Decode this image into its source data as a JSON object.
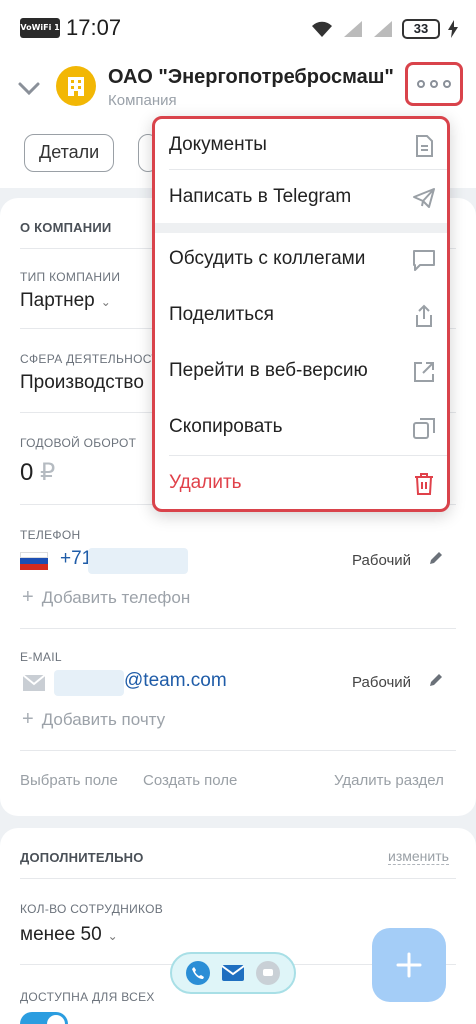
{
  "status_bar": {
    "network_badge": "VoWiFi 1",
    "time": "17:07",
    "battery": "33"
  },
  "header": {
    "title": "ОАО \"Энергопотребросмаш\"",
    "subtitle": "Компания"
  },
  "tabs": [
    {
      "label": "Детали"
    }
  ],
  "about": {
    "section_title": "О КОМПАНИИ",
    "company_type_label": "ТИП КОМПАНИИ",
    "company_type_value": "Партнер",
    "industry_label": "СФЕРА ДЕЯТЕЛЬНОСТ",
    "industry_value": "Производство",
    "revenue_label": "ГОДОВОЙ ОБОРОТ",
    "revenue_value": "0",
    "revenue_currency": "₽",
    "phone_label": "ТЕЛЕФОН",
    "phone_value": "+71",
    "phone_type": "Рабочий",
    "add_phone": "Добавить телефон",
    "email_label": "E-MAIL",
    "email_value": "@team.com",
    "email_type": "Рабочий",
    "add_email": "Добавить почту",
    "select_field": "Выбрать поле",
    "create_field": "Создать поле",
    "delete_section": "Удалить раздел"
  },
  "extra": {
    "section_title": "ДОПОЛНИТЕЛЬНО",
    "edit_link": "изменить",
    "employees_label": "КОЛ-ВО СОТРУДНИКОВ",
    "employees_value": "менее 50",
    "available_label": "ДОСТУПНА ДЛЯ ВСЕХ",
    "available_on": true
  },
  "menu": {
    "items": [
      {
        "label": "Документы",
        "icon": "document-icon"
      },
      {
        "label": "Написать в Telegram",
        "icon": "telegram-icon"
      },
      {
        "label": "Обсудить с коллегами",
        "icon": "chat-icon"
      },
      {
        "label": "Поделиться",
        "icon": "share-icon"
      },
      {
        "label": "Перейти в веб-версию",
        "icon": "external-link-icon"
      },
      {
        "label": "Скопировать",
        "icon": "copy-icon"
      },
      {
        "label": "Удалить",
        "icon": "trash-icon",
        "danger": true
      }
    ]
  },
  "colors": {
    "accent": "#2b9de0",
    "danger": "#e0414a",
    "highlight": "#d9434b",
    "avatar": "#f2b705"
  }
}
